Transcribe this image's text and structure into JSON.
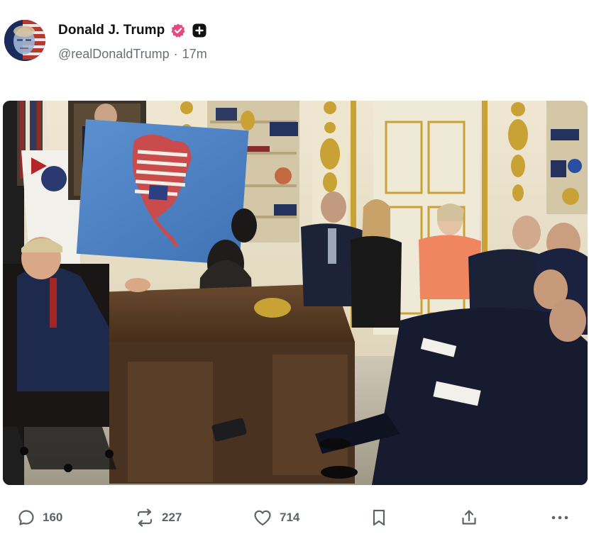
{
  "author": {
    "display_name": "Donald J. Trump",
    "handle": "@realDonaldTrump",
    "separator": "·",
    "time_ago": "17m",
    "verified_badge_icon": "verified-badge-icon",
    "plus_badge_icon": "plus-badge-icon"
  },
  "media": {
    "type": "photo",
    "description_icon": "photo-icon"
  },
  "actions": {
    "reply_count": "160",
    "repost_count": "227",
    "like_count": "714",
    "reply_icon": "reply-icon",
    "repost_icon": "repost-icon",
    "like_icon": "heart-icon",
    "bookmark_icon": "bookmark-icon",
    "share_icon": "share-icon",
    "more_icon": "more-icon"
  },
  "colors": {
    "verified_badge": "#e8477f",
    "plus_badge": "#111111",
    "meta_text": "#6b6f76",
    "action_icon": "#5e6269"
  }
}
